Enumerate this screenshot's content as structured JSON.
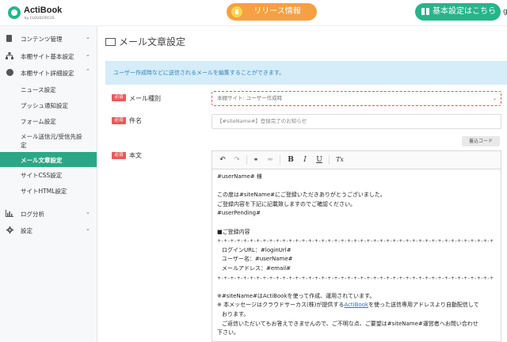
{
  "header": {
    "logo_text": "ActiBook",
    "logo_sub": "by CLOUDCIRCUS",
    "release_label": "リリース情報",
    "settings_label": "基本設定はこちら",
    "edge_char": "g"
  },
  "sidebar": {
    "items": [
      {
        "label": "コンテンツ管理",
        "icon": "document-icon",
        "chev": "⌄"
      },
      {
        "label": "本棚サイト基本設定",
        "icon": "sitemap-icon",
        "chev": "⌄"
      },
      {
        "label": "本棚サイト詳細設定",
        "icon": "globe-icon",
        "chev": "⌃"
      }
    ],
    "subitems": [
      {
        "label": "ニュース設定"
      },
      {
        "label": "プッシュ通知設定"
      },
      {
        "label": "フォーム設定"
      },
      {
        "label1": "メール送信元/受信先設",
        "label2": "定"
      },
      {
        "label": "メール文章設定"
      },
      {
        "label": "サイトCSS設定"
      },
      {
        "label": "サイトHTML設定"
      }
    ],
    "bottom_items": [
      {
        "label": "ログ分析",
        "icon": "bar-chart-icon",
        "chev": "⌄"
      },
      {
        "label": "設定",
        "icon": "gear-icon",
        "chev": "⌄"
      }
    ]
  },
  "main": {
    "title": "メール文章設定",
    "banner": "ユーザー作成時などに送信されるメールを編集することができます。",
    "required_badge": "必須",
    "mail_type_label": "メール種別",
    "mail_type_value": "本棚サイト: ユーザー作成時",
    "subject_label": "件名",
    "subject_value": "【#siteName#】登録完了のお知らせ",
    "source_button": "蓋込コード",
    "body_label": "本文",
    "toolbar": {
      "undo": "↶",
      "redo": "↷",
      "link": "🔗",
      "unlink": "⛓",
      "bold": "B",
      "italic": "I",
      "underline": "U",
      "clear": "Tx"
    },
    "body_lines": {
      "l1": "#userName# 様",
      "l2": "この度は#siteName#にご登録いただきありがとうございました。",
      "l3": "ご登録内容を下記に記載致しますのでご確認ください。",
      "l4": "#userPending#",
      "l5": "■ご登録内容",
      "sep": "+-+-+-+-+-+-+-+-+-+-+-+-+-+-+-+-+-+-+-+-+-+-+-+-+-+-+-+-+-+-+-+-+-+-+-+-+-+-+-+-+-+-+",
      "l6": "ログインURL：#loginUrl#",
      "l7": "ユーザー名：#userName#",
      "l8": "メールアドレス：#email#",
      "l9": "※#siteName#はActiBookを使って作成、運用されています。",
      "l10a": "※ 本メッセージはクラウドサーカス(株)が提供する",
      "l10link": "ActiBook",
      "l10b": "を使った送信専用アドレスより自動配信して",
      "l11": "おります。",
      "l12": "ご返信いただいてもお答えできませんので、ご不明な点、ご要望は#siteName#運営者へお問い合わせ",
      "l13": "下さい。"
    }
  }
}
